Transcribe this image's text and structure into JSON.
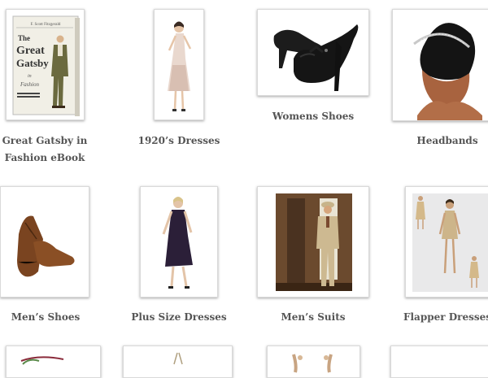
{
  "products": [
    {
      "id": "gatsby-ebook",
      "label": "Great Gatsby in Fashion eBook",
      "cover": {
        "author": "F. Scott Fitzgerald",
        "title_line1": "The",
        "title_line2": "Great",
        "title_line3": "Gatsby",
        "sub1": "in",
        "sub2": "Fashion"
      }
    },
    {
      "id": "dresses-1920",
      "label": "1920’s Dresses"
    },
    {
      "id": "womens-shoes",
      "label": "Womens Shoes"
    },
    {
      "id": "headbands",
      "label": "Headbands"
    },
    {
      "id": "mens-shoes",
      "label": "Men’s Shoes"
    },
    {
      "id": "plus-size-dresses",
      "label": "Plus Size Dresses"
    },
    {
      "id": "mens-suits",
      "label": "Men’s Suits"
    },
    {
      "id": "flapper-dresses",
      "label": "Flapper Dresses"
    }
  ]
}
